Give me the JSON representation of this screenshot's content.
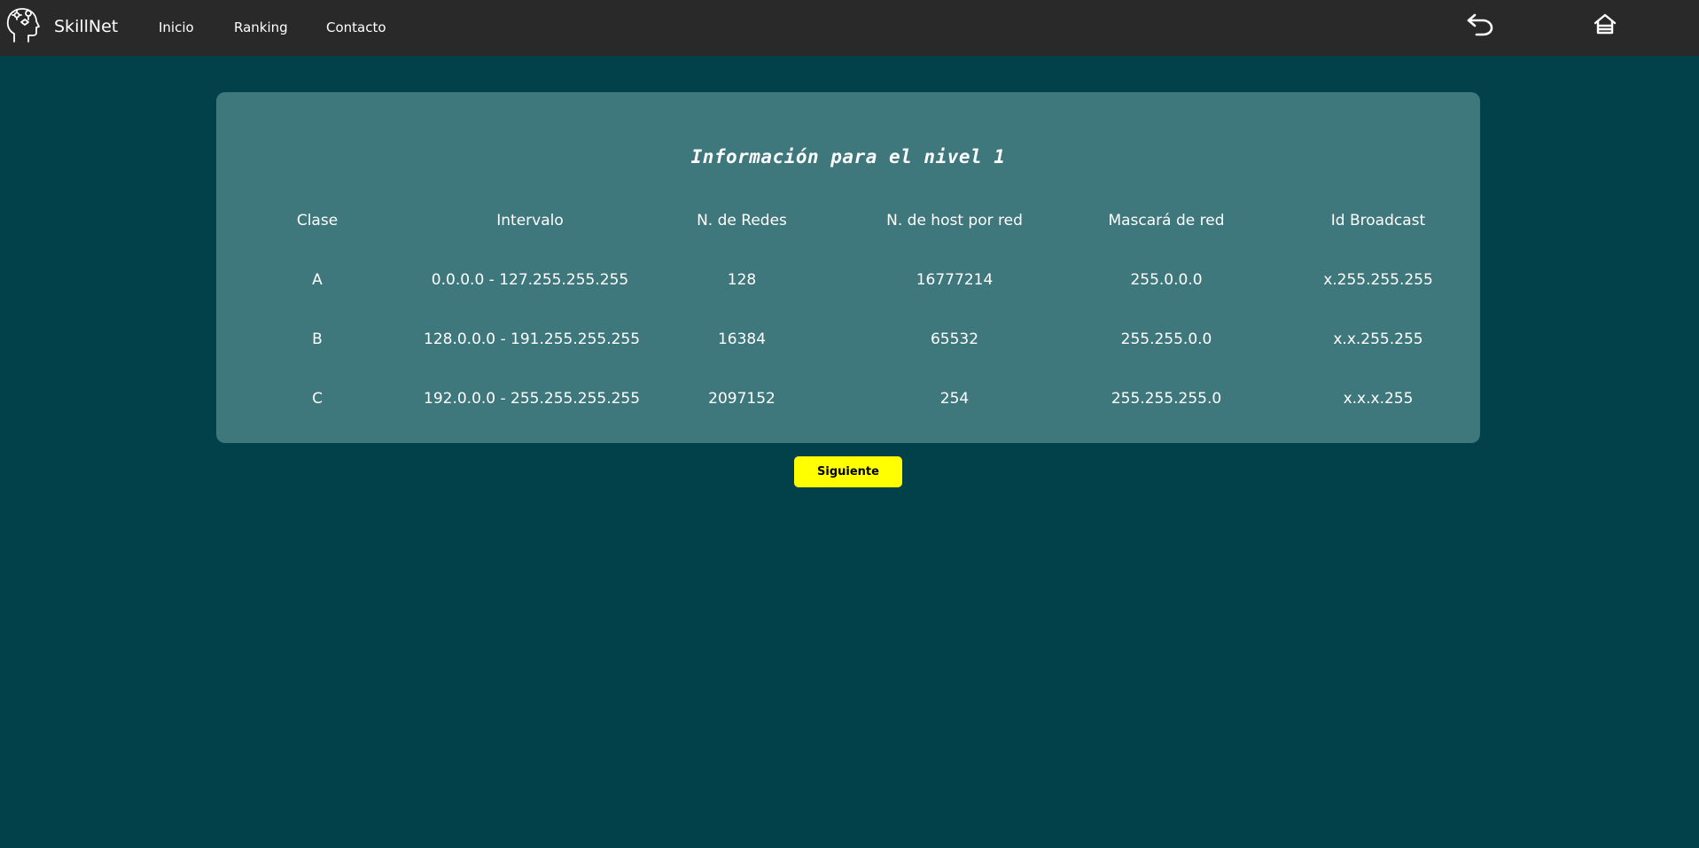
{
  "navbar": {
    "brand": "SkillNet",
    "links": [
      "Inicio",
      "Ranking",
      "Contacto"
    ],
    "icons": {
      "logo": "head-gears-icon",
      "back": "back-arrow-icon",
      "home": "home-icon"
    }
  },
  "card": {
    "title": "Información para el nivel 1",
    "headers": [
      "Clase",
      "Intervalo",
      "N. de Redes",
      "N. de host por red",
      "Mascará de red",
      "Id Broadcast"
    ],
    "rows": [
      [
        "A",
        "0.0.0.0 - 127.255.255.255",
        "128",
        "16777214",
        "255.0.0.0",
        "x.255.255.255"
      ],
      [
        "B",
        "128.0.0.0 - 191.255.255.255",
        "16384",
        "65532",
        "255.255.0.0",
        "x.x.255.255"
      ],
      [
        "C",
        "192.0.0.0 - 255.255.255.255",
        "2097152",
        "254",
        "255.255.255.0",
        "x.x.x.255"
      ]
    ]
  },
  "next_button": "Siguiente",
  "colors": {
    "background": "#024149",
    "navbar": "#292929",
    "card": "#3e777c",
    "button": "#ffff00"
  }
}
